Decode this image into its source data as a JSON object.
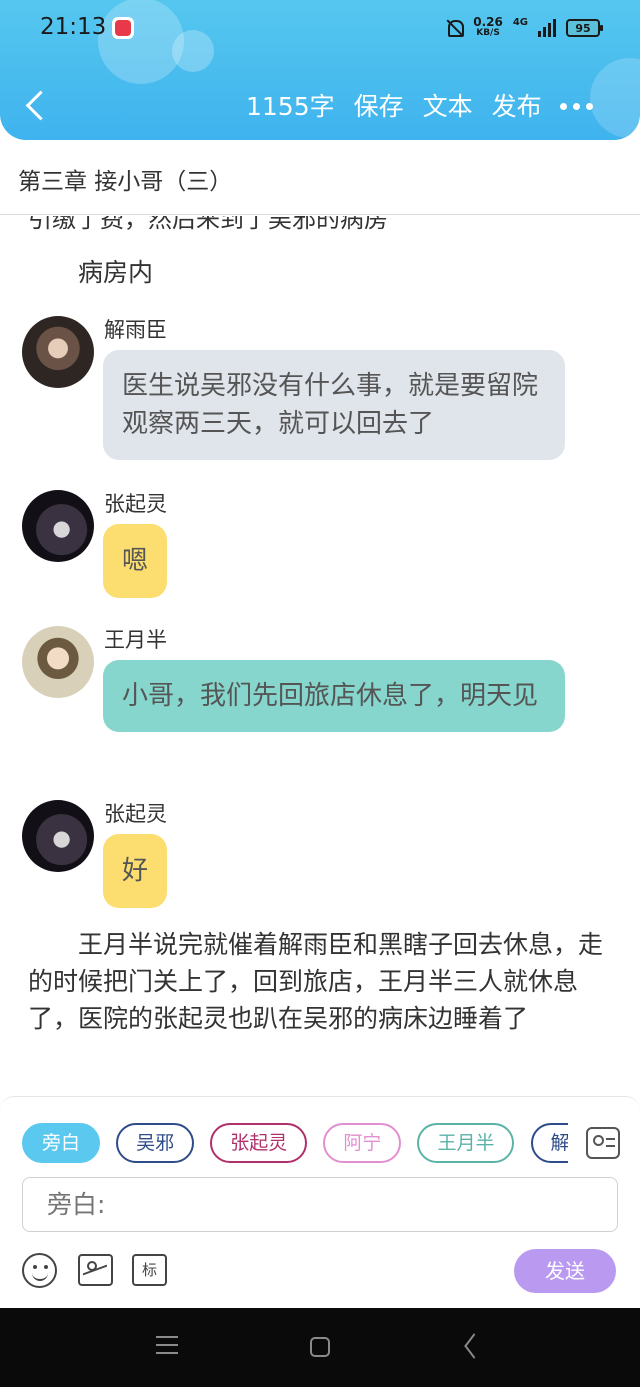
{
  "status_bar": {
    "time": "21:13",
    "net_speed": "0.26",
    "net_unit": "KB/S",
    "network": "4G",
    "battery": "95"
  },
  "header": {
    "word_count": "1155字",
    "save": "保存",
    "text": "文本",
    "publish": "发布",
    "bg_color": "#4bbdef"
  },
  "chapter": {
    "title": "第三章 接小哥（三）"
  },
  "content": {
    "cut_line": "引缴了费，然后来到了吴邪的病房",
    "narration_1": "病房内",
    "messages": [
      {
        "speaker": "解雨臣",
        "text": "医生说吴邪没有什么事，就是要留院观察两三天，就可以回去了",
        "bubble_color": "#e0e5eb"
      },
      {
        "speaker": "张起灵",
        "text": "嗯",
        "bubble_color": "#fbde6f"
      },
      {
        "speaker": "王月半",
        "text": "小哥，我们先回旅店休息了，明天见",
        "bubble_color": "#86d6cd"
      },
      {
        "speaker": "张起灵",
        "text": "好",
        "bubble_color": "#fbde6f"
      }
    ],
    "narration_2": "王月半说完就催着解雨臣和黑瞎子回去休息，走的时候把门关上了，回到旅店，王月半三人就休息了，医院的张起灵也趴在吴邪的病床边睡着了"
  },
  "composer": {
    "chips": [
      {
        "label": "旁白",
        "color": "#5bc8ef",
        "active": true
      },
      {
        "label": "吴邪",
        "color": "#2f4c8a"
      },
      {
        "label": "张起灵",
        "color": "#b0306a"
      },
      {
        "label": "阿宁",
        "color": "#e28fd0"
      },
      {
        "label": "王月半",
        "color": "#5bb2a7"
      },
      {
        "label": "解雨臣",
        "color": "#2f4c8a"
      }
    ],
    "input_placeholder": "旁白:",
    "mark_label": "标",
    "send_label": "发送",
    "send_color": "#b99af0"
  }
}
